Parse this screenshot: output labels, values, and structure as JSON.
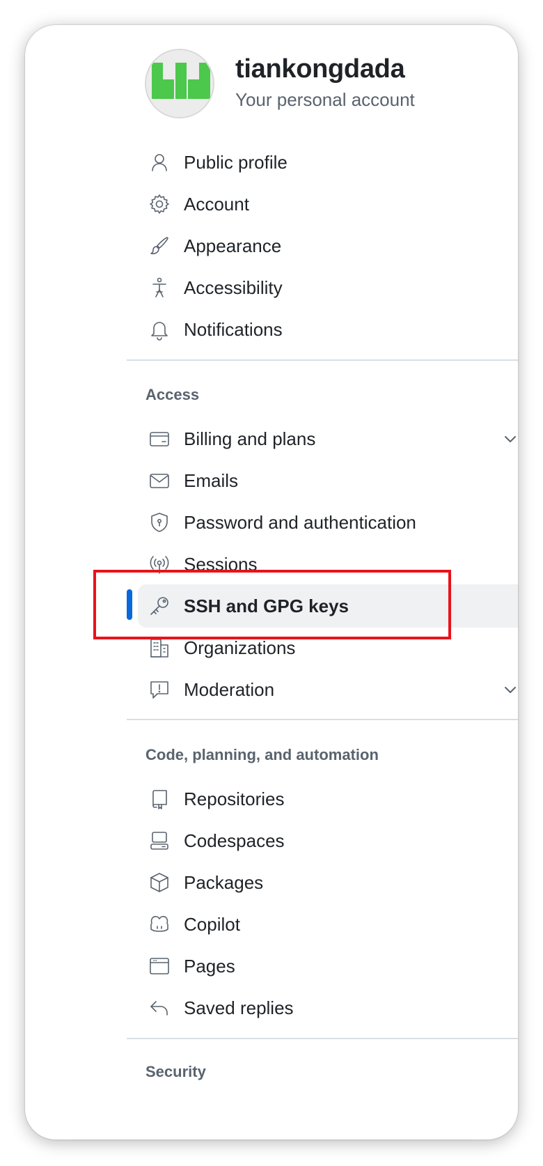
{
  "account": {
    "username": "tiankongdada",
    "subtitle": "Your personal account",
    "avatar_color": "#4cc84c"
  },
  "nav": {
    "personal": [
      {
        "label": "Public profile",
        "icon": "person-icon"
      },
      {
        "label": "Account",
        "icon": "gear-icon"
      },
      {
        "label": "Appearance",
        "icon": "paintbrush-icon"
      },
      {
        "label": "Accessibility",
        "icon": "accessibility-icon"
      },
      {
        "label": "Notifications",
        "icon": "bell-icon"
      }
    ],
    "access_title": "Access",
    "access": [
      {
        "label": "Billing and plans",
        "icon": "credit-card-icon",
        "expandable": true
      },
      {
        "label": "Emails",
        "icon": "mail-icon"
      },
      {
        "label": "Password and authentication",
        "icon": "shield-lock-icon"
      },
      {
        "label": "Sessions",
        "icon": "broadcast-icon"
      },
      {
        "label": "SSH and GPG keys",
        "icon": "key-icon",
        "selected": true
      },
      {
        "label": "Organizations",
        "icon": "organization-icon"
      },
      {
        "label": "Moderation",
        "icon": "report-icon",
        "expandable": true
      }
    ],
    "code_title": "Code, planning, and automation",
    "code": [
      {
        "label": "Repositories",
        "icon": "repo-icon"
      },
      {
        "label": "Codespaces",
        "icon": "codespaces-icon"
      },
      {
        "label": "Packages",
        "icon": "package-icon"
      },
      {
        "label": "Copilot",
        "icon": "copilot-icon"
      },
      {
        "label": "Pages",
        "icon": "browser-icon"
      },
      {
        "label": "Saved replies",
        "icon": "reply-icon"
      }
    ],
    "security_title_partial": "Security"
  },
  "colors": {
    "accent": "#0969da",
    "highlight_box": "#e8131b",
    "selected_bg": "#eff1f3"
  }
}
